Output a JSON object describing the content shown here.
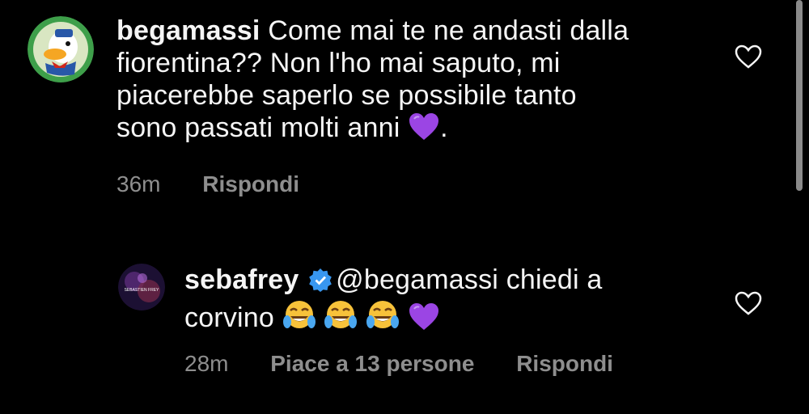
{
  "comments": [
    {
      "username": "begamassi",
      "text_lines": [
        "Come mai te ne andasti dalla",
        "fiorentina?? Non l'ho mai saputo, mi",
        "piacerebbe saperlo se possibile tanto",
        "sono passati molti anni"
      ],
      "trailing": ".",
      "emoji": "purple-heart",
      "time": "36m",
      "reply_label": "Rispondi"
    },
    {
      "username": "sebafrey",
      "mention": "@begamassi",
      "text_line1": " chiedi a",
      "text_line2": "corvino",
      "emojis": [
        "laughing-tears",
        "laughing-tears",
        "laughing-tears",
        "purple-heart"
      ],
      "time": "28m",
      "likes_label": "Piace a 13 persone",
      "reply_label": "Rispondi",
      "avatar_text": "SEBASTIEN FREY"
    }
  ],
  "colors": {
    "background": "#000000",
    "text": "#f5f5f5",
    "meta": "#8e8e8e",
    "verified": "#3897f0",
    "purple_heart": "#9b45e4"
  },
  "icons": [
    "like-heart-icon",
    "verified-badge-icon",
    "purple-heart-emoji",
    "laughing-tears-emoji"
  ]
}
